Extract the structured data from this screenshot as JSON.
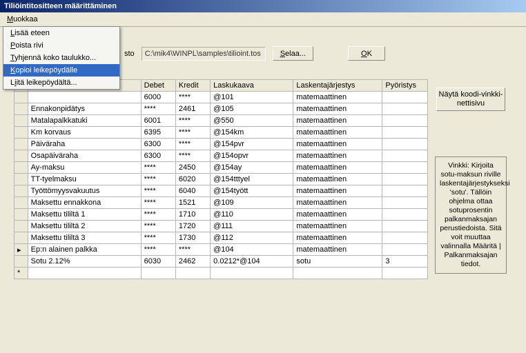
{
  "title": "Tiliöintitositteen määrittäminen",
  "menubar": {
    "muokkaa": "Muokkaa"
  },
  "menu": {
    "items": [
      {
        "label": "Lisää eteen"
      },
      {
        "label": "Poista rivi"
      },
      {
        "label": "Tyhjennä koko taulukko..."
      },
      {
        "label": "Kopioi leikepöydälle"
      },
      {
        "label": "Liitä leikepöydältä..."
      }
    ]
  },
  "toprow": {
    "label_suffix": "sto",
    "path": "C:\\mik4\\WINPL\\samples\\tilioint.tos",
    "selaa": "Selaa...",
    "ok": "OK"
  },
  "headers": {
    "name": "",
    "debet": "Debet",
    "kredit": "Kredit",
    "laskukaava": "Laskukaava",
    "laskentajarjestys": "Laskentajärjestys",
    "pyoristys": "Pyöristys"
  },
  "rows": [
    {
      "ind": "",
      "name": "",
      "deb": "6000",
      "kre": "****",
      "laskuk": "@101",
      "laskj": "matemaattinen",
      "pyor": ""
    },
    {
      "ind": "",
      "name": "Ennakonpidätys",
      "deb": "****",
      "kre": "2461",
      "laskuk": "@105",
      "laskj": "matemaattinen",
      "pyor": ""
    },
    {
      "ind": "",
      "name": "Matalapalkkatuki",
      "deb": "6001",
      "kre": "****",
      "laskuk": "@550",
      "laskj": "matemaattinen",
      "pyor": ""
    },
    {
      "ind": "",
      "name": "Km korvaus",
      "deb": "6395",
      "kre": "****",
      "laskuk": "@154km",
      "laskj": "matemaattinen",
      "pyor": ""
    },
    {
      "ind": "",
      "name": "Päiväraha",
      "deb": "6300",
      "kre": "****",
      "laskuk": "@154pvr",
      "laskj": "matemaattinen",
      "pyor": ""
    },
    {
      "ind": "",
      "name": "Osapäiväraha",
      "deb": "6300",
      "kre": "****",
      "laskuk": "@154opvr",
      "laskj": "matemaattinen",
      "pyor": ""
    },
    {
      "ind": "",
      "name": "Ay-maksu",
      "deb": "****",
      "kre": "2450",
      "laskuk": "@154ay",
      "laskj": "matemaattinen",
      "pyor": ""
    },
    {
      "ind": "",
      "name": "TT-tyelmaksu",
      "deb": "****",
      "kre": "6020",
      "laskuk": "@154tttyel",
      "laskj": "matemaattinen",
      "pyor": ""
    },
    {
      "ind": "",
      "name": "Työttömyysvakuutus",
      "deb": "****",
      "kre": "6040",
      "laskuk": "@154tyött",
      "laskj": "matemaattinen",
      "pyor": ""
    },
    {
      "ind": "",
      "name": "Maksettu ennakkona",
      "deb": "****",
      "kre": "1521",
      "laskuk": "@109",
      "laskj": "matemaattinen",
      "pyor": ""
    },
    {
      "ind": "",
      "name": "Maksettu tililtä 1",
      "deb": "****",
      "kre": "1710",
      "laskuk": "@110",
      "laskj": "matemaattinen",
      "pyor": ""
    },
    {
      "ind": "",
      "name": "Maksettu tililtä 2",
      "deb": "****",
      "kre": "1720",
      "laskuk": "@111",
      "laskj": "matemaattinen",
      "pyor": ""
    },
    {
      "ind": "",
      "name": "Maksettu tililtä 3",
      "deb": "****",
      "kre": "1730",
      "laskuk": "@112",
      "laskj": "matemaattinen",
      "pyor": ""
    },
    {
      "ind": "▸",
      "name": "Ep:n alainen palkka",
      "deb": "****",
      "kre": "****",
      "laskuk": "@104",
      "laskj": "matemaattinen",
      "pyor": ""
    },
    {
      "ind": "",
      "name": "Sotu 2.12%",
      "deb": "6030",
      "kre": "2462",
      "laskuk": "0.0212*@104",
      "laskj": "sotu",
      "pyor": "3"
    },
    {
      "ind": "*",
      "name": "",
      "deb": "",
      "kre": "",
      "laskuk": "",
      "laskj": "",
      "pyor": ""
    }
  ],
  "sidebtn": "Näytä koodi-vinkki-nettisivu",
  "tip": "Vinkki: Kirjoita sotu-maksun riville laskentajärjestykseksi 'sotu'. Tällöin ohjelma ottaa sotuprosentin palkanmaksajan perustiedoista. Sitä voit muuttaa valinnalla Määritä | Palkanmaksajan tiedot."
}
